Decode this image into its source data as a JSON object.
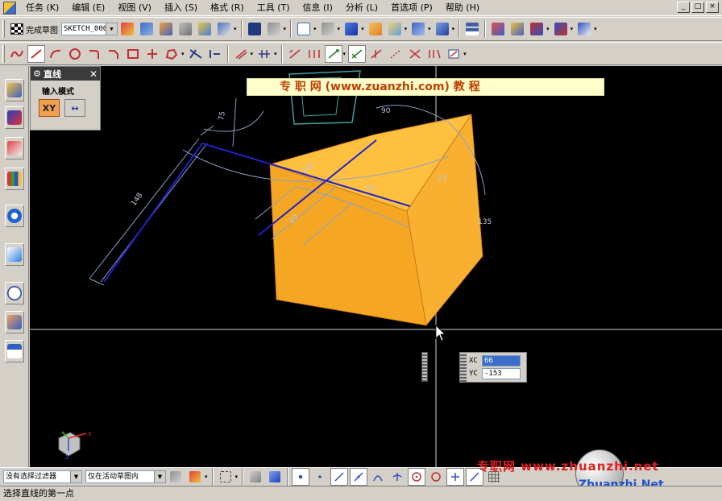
{
  "menu": {
    "items": [
      "任务 (K)",
      "编辑 (E)",
      "视图 (V)",
      "插入 (S)",
      "格式 (R)",
      "工具 (T)",
      "信息 (I)",
      "分析 (L)",
      "首选项 (P)",
      "帮助 (H)"
    ],
    "window_buttons": [
      "_",
      "□",
      "×"
    ]
  },
  "toolbar": {
    "finish_sketch_label": "完成草图",
    "sketch_name": "SKETCH_000"
  },
  "line_dialog": {
    "title": "直线",
    "input_mode_label": "输入模式",
    "mode_xy": "XY",
    "mode_parametric": "↔"
  },
  "banner": {
    "text": "专 职 网 (www.zuanzhi.com) 教 程"
  },
  "dimensions": {
    "d1": "148",
    "d2": "75",
    "d3": "90",
    "d4": "100",
    "d5": "55",
    "d6": "25",
    "d7": "60",
    "d8": "135"
  },
  "coord_input": {
    "xc_label": "XC",
    "xc_value": "66",
    "yc_label": "YC",
    "yc_value": "-153"
  },
  "bottom": {
    "filter_value": "没有选择过滤器",
    "scope_value": "仅在活动草图内"
  },
  "status": {
    "text": "选择直线的第一点"
  },
  "watermark": {
    "cn": "专职网  www.zhuanzhi.net",
    "en": "Zhuanzhi.Net"
  },
  "triad": {
    "x_label": "X",
    "z_label": "Z"
  },
  "colors": {
    "cube_front": "#f5a623",
    "cube_top": "#ffc040",
    "cube_side": "#f9b030",
    "sketch_line": "#2020c8",
    "dimension": "#8aa0c8",
    "viewport_bg": "#000000"
  }
}
